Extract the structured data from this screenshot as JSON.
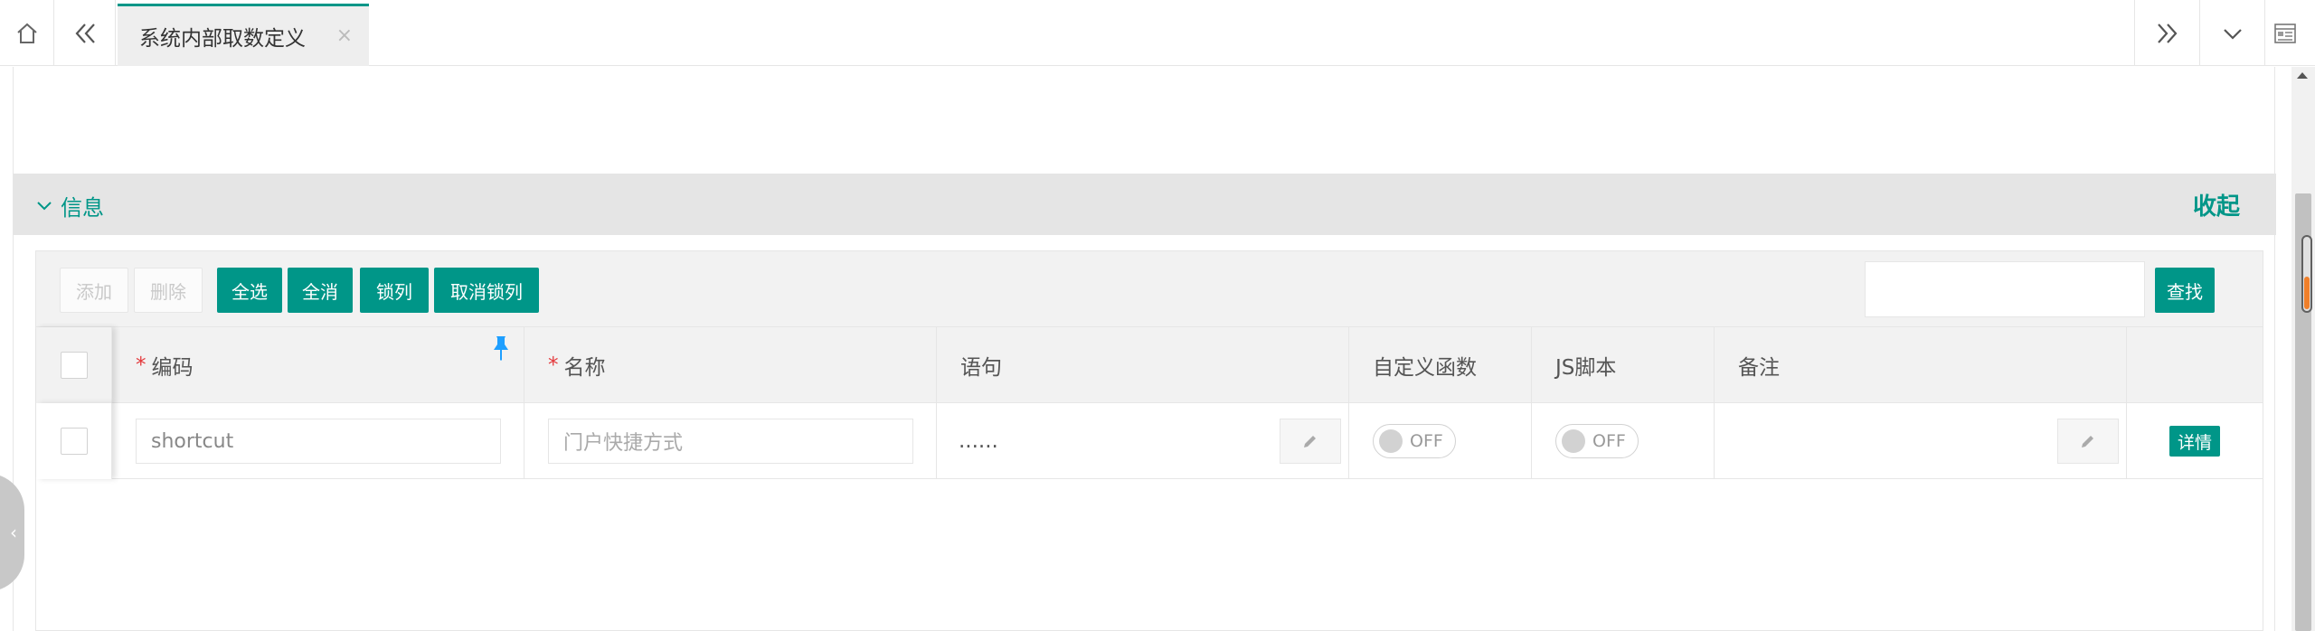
{
  "tabbar": {
    "active_tab": "系统内部取数定义",
    "close_glyph": "×"
  },
  "section": {
    "title": "信息",
    "collapse_label": "收起"
  },
  "toolbar": {
    "add": "添加",
    "delete": "删除",
    "select_all": "全选",
    "deselect_all": "全消",
    "lock_column": "锁列",
    "unlock_column": "取消锁列",
    "search_value": "",
    "search_button": "查找"
  },
  "table": {
    "headers": {
      "code": "编码",
      "name": "名称",
      "statement": "语句",
      "custom_func": "自定义函数",
      "js_script": "JS脚本",
      "remark": "备注"
    },
    "rows": [
      {
        "code": "shortcut",
        "name_placeholder": "门户快捷方式",
        "statement": "......",
        "custom_func": "OFF",
        "js_script": "OFF",
        "remark": "",
        "detail": "详情"
      }
    ]
  },
  "colors": {
    "accent": "#009688",
    "required": "#e4393c",
    "pin": "#1e9fff"
  }
}
